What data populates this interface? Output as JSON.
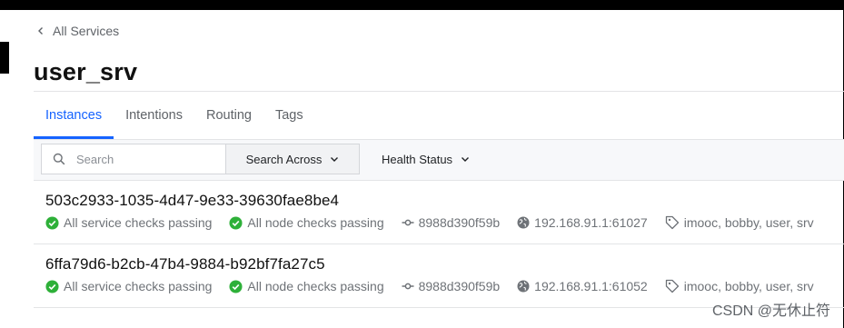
{
  "breadcrumb": {
    "label": "All Services"
  },
  "page_title": "user_srv",
  "tabs": [
    {
      "label": "Instances",
      "active": true
    },
    {
      "label": "Intentions",
      "active": false
    },
    {
      "label": "Routing",
      "active": false
    },
    {
      "label": "Tags",
      "active": false
    }
  ],
  "search": {
    "placeholder": "Search",
    "across_label": "Search Across"
  },
  "filters": {
    "health_status_label": "Health Status"
  },
  "instances": [
    {
      "id": "503c2933-1035-4d47-9e33-39630fae8be4",
      "service_checks": "All service checks passing",
      "node_checks": "All node checks passing",
      "node": "8988d390f59b",
      "address": "192.168.91.1:61027",
      "tags": "imooc, bobby, user, srv"
    },
    {
      "id": "6ffa79d6-b2cb-47b4-9884-b92bf7fa27c5",
      "service_checks": "All service checks passing",
      "node_checks": "All node checks passing",
      "node": "8988d390f59b",
      "address": "192.168.91.1:61052",
      "tags": "imooc, bobby, user, srv"
    }
  ],
  "watermark": "CSDN @无休止符",
  "colors": {
    "accent": "#1563ff",
    "passing": "#2eb039",
    "muted": "#6e7277"
  },
  "icons": [
    "chevron-left-icon",
    "search-icon",
    "chevron-down-icon",
    "check-circle-icon",
    "node-icon",
    "globe-icon",
    "tag-icon"
  ]
}
